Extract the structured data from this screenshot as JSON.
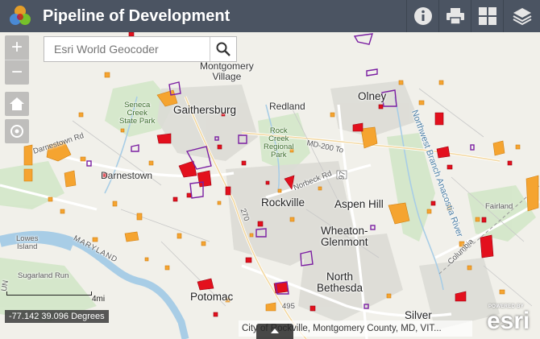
{
  "header": {
    "title": "Pipeline of Development",
    "buttons": [
      {
        "name": "info-button",
        "icon": "info-icon"
      },
      {
        "name": "print-button",
        "icon": "printer-icon"
      },
      {
        "name": "basemap-button",
        "icon": "grid-icon"
      },
      {
        "name": "layers-button",
        "icon": "layers-icon"
      }
    ]
  },
  "search": {
    "placeholder": "Esri World Geocoder"
  },
  "map_controls": {
    "zoom_in": "+",
    "zoom_out": "−",
    "home_icon": "home-icon",
    "locate_icon": "locate-icon"
  },
  "coordinates": "-77.142 39.096 Degrees",
  "scale_label": "4mi",
  "attribution": "City of Rockville, Montgomery County, MD, VIT...",
  "esri": {
    "powered": "POWERED BY",
    "word": "esri"
  },
  "map_labels": {
    "gaithersburg": "Gaithersburg",
    "montgomery_village": "Montgomery\nVillage",
    "redland": "Redland",
    "olney": "Olney",
    "seneca": "Seneca\nCreek\nState Park",
    "rock_creek": "Rock\nCreek\nRegional\nPark",
    "darnestown": "Darnestown",
    "rockville": "Rockville",
    "aspen_hill": "Aspen Hill",
    "wheaton": "Wheaton-\nGlenmont",
    "north_bethesda": "North\nBethesda",
    "potomac": "Potomac",
    "fairland": "Fairland",
    "lowes_island": "Lowes\nIsland",
    "sugarland_run": "Sugarland Run",
    "maryland": "MARYLAND",
    "silver": "Silver",
    "md200": "MD-200 To",
    "norbeck": "Norbeck Rd",
    "nw_branch": "Northwest Branch Anacostia River",
    "columbia": "Columbia",
    "darnestown_rd": "Darnestown Rd",
    "i270": "270",
    "i495": "495",
    "n97": "97",
    "jun": "UN"
  },
  "colors": {
    "header_bg": "#4b5462",
    "red_parcel": "#e3101d",
    "orange_parcel": "#f5a430",
    "purple_parcel": "#7b1fa2",
    "river": "#a8cde6"
  }
}
